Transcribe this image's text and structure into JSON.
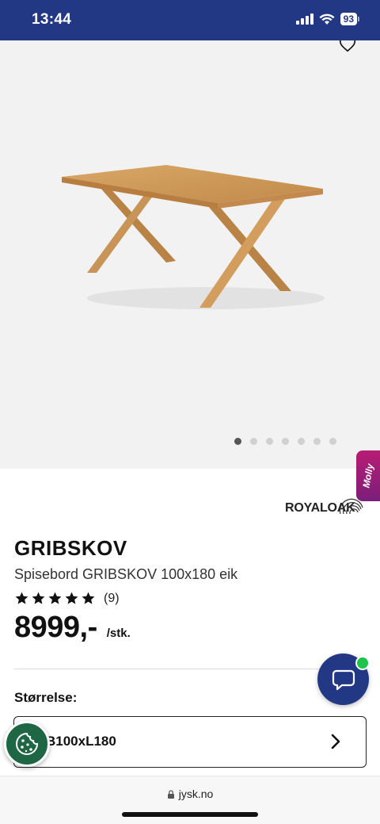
{
  "status_bar": {
    "time": "13:44",
    "battery": "93"
  },
  "gallery": {
    "slide_count": 7,
    "active_index": 0
  },
  "molly": {
    "label": "Molly"
  },
  "brand": {
    "name": "ROYALOAK"
  },
  "product": {
    "name": "GRIBSKOV",
    "description": "Spisebord GRIBSKOV 100x180 eik",
    "rating": 5,
    "review_count": "(9)",
    "price": "8999,-",
    "unit": "/stk."
  },
  "size": {
    "label": "Størrelse:",
    "value": "B100xL180"
  },
  "browser": {
    "url": "jysk.no"
  },
  "colors": {
    "brand_blue": "#233884",
    "cookie_green": "#1e6644",
    "online_green": "#1ec34a",
    "molly_pink": "#b81c74"
  }
}
